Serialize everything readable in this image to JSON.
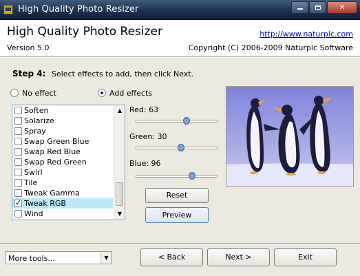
{
  "window": {
    "title": "High Quality Photo Resizer",
    "close_label": "✕"
  },
  "header": {
    "app_title": "High Quality Photo Resizer",
    "version": "Version 5.0",
    "url": "http://www.naturpic.com",
    "copyright": "Copyright (C) 2006-2009 Naturpic Software"
  },
  "step": {
    "label": "Step 4:",
    "description": "Select effects to add, then click Next."
  },
  "mode": {
    "options": [
      {
        "label": "No effect",
        "selected": false
      },
      {
        "label": "Add effects",
        "selected": true
      }
    ]
  },
  "effects": {
    "items": [
      {
        "label": "Soften",
        "checked": false
      },
      {
        "label": "Solarize",
        "checked": false
      },
      {
        "label": "Spray",
        "checked": false
      },
      {
        "label": "Swap Green Blue",
        "checked": false
      },
      {
        "label": "Swap Red Blue",
        "checked": false
      },
      {
        "label": "Swap Red Green",
        "checked": false
      },
      {
        "label": "Swirl",
        "checked": false
      },
      {
        "label": "Tile",
        "checked": false
      },
      {
        "label": "Tweak Gamma",
        "checked": false
      },
      {
        "label": "Tweak RGB",
        "checked": true,
        "selected": true
      },
      {
        "label": "Wind",
        "checked": false
      }
    ],
    "scroll_up": "▲",
    "scroll_down": "▼"
  },
  "rgb": {
    "red": {
      "label": "Red: 63",
      "value": 63
    },
    "green": {
      "label": "Green: 30",
      "value": 30
    },
    "blue": {
      "label": "Blue: 96",
      "value": 96
    },
    "slider_min": -255,
    "slider_max": 255
  },
  "buttons": {
    "reset": "Reset",
    "preview": "Preview",
    "back": "< Back",
    "next": "Next >",
    "exit": "Exit"
  },
  "footer": {
    "more_tools": "More tools...",
    "combo_arrow": "▼"
  },
  "colors": {
    "title_bar": "#1f3453",
    "panel": "#ebe9e0",
    "selection": "#bde8f8",
    "link": "#0000cc"
  }
}
